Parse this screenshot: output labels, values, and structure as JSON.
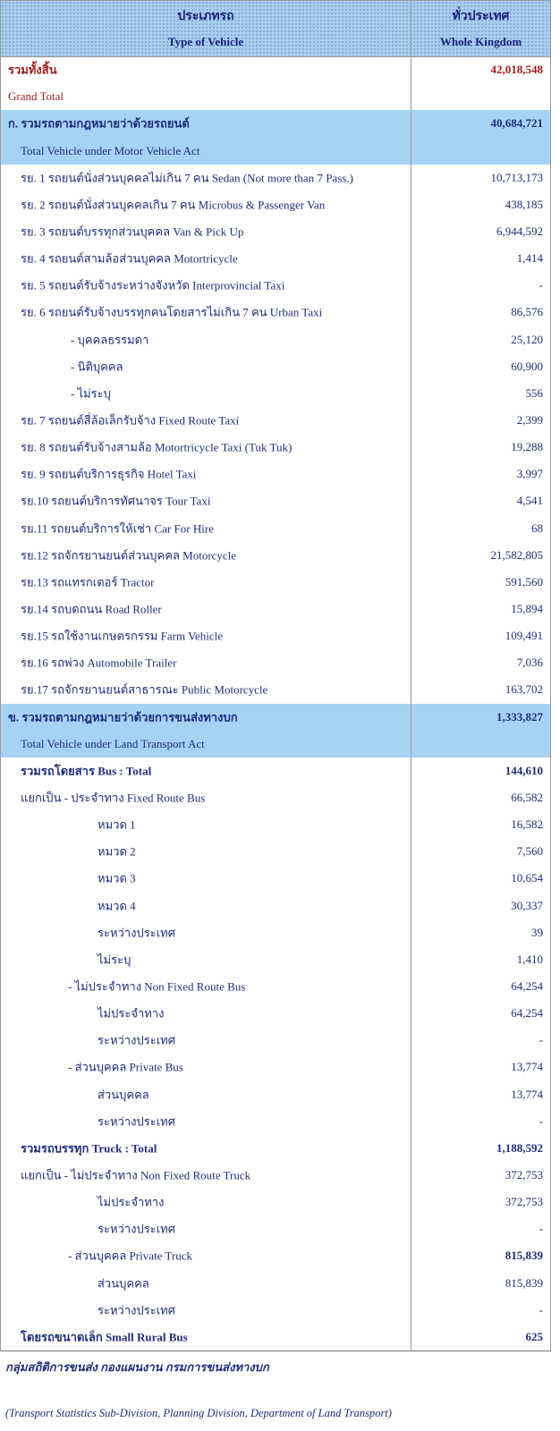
{
  "header": {
    "col1_th": "ประเภทรถ",
    "col1_en": "Type of Vehicle",
    "col2_th": "ทั่วประเทศ",
    "col2_en": "Whole Kingdom"
  },
  "rows": [
    {
      "label": "รวมทั้งสิ้น",
      "value": "42,018,548",
      "indent": 8,
      "style": "red-bold"
    },
    {
      "label": "Grand Total",
      "value": "",
      "indent": 8,
      "style": "red"
    },
    {
      "label": "ก. รวมรถตามกฎหมายว่าด้วยรถยนต์",
      "value": "40,684,721",
      "indent": 8,
      "style": "bold",
      "hl": true
    },
    {
      "label": "Total Vehicle under Motor Vehicle Act",
      "value": "",
      "indent": 22,
      "style": "",
      "hl": true
    },
    {
      "label": "รย. 1 รถยนต์นั่งส่วนบุคคลไม่เกิน 7 คน Sedan (Not more than 7 Pass.)",
      "value": "10,713,173",
      "indent": 22
    },
    {
      "label": "รย. 2 รถยนต์นั่งส่วนบุคคลเกิน 7 คน Microbus & Passenger Van",
      "value": "438,185",
      "indent": 22
    },
    {
      "label": "รย. 3 รถยนต์บรรทุกส่วนบุคคล Van & Pick Up",
      "value": "6,944,592",
      "indent": 22
    },
    {
      "label": "รย. 4 รถยนต์สามล้อส่วนบุคคล Motortricycle",
      "value": "1,414",
      "indent": 22
    },
    {
      "label": "รย. 5 รถยนต์รับจ้างระหว่างจังหวัด Interprovincial Taxi",
      "value": "-",
      "indent": 22
    },
    {
      "label": "รย. 6 รถยนต์รับจ้างบรรทุกคนโดยสารไม่เกิน 7 คน Urban Taxi",
      "value": "86,576",
      "indent": 22
    },
    {
      "label": "- บุคคลธรรมดา",
      "value": "25,120",
      "indent": 78
    },
    {
      "label": "- นิติบุคคล",
      "value": "60,900",
      "indent": 78
    },
    {
      "label": "- ไม่ระบุ",
      "value": "556",
      "indent": 78
    },
    {
      "label": "รย. 7 รถยนต์สี่ล้อเล็กรับจ้าง Fixed Route Taxi",
      "value": "2,399",
      "indent": 22
    },
    {
      "label": "รย. 8 รถยนต์รับจ้างสามล้อ Motortricycle Taxi (Tuk Tuk)",
      "value": "19,288",
      "indent": 22
    },
    {
      "label": "รย. 9 รถยนต์บริการธุรกิจ Hotel Taxi",
      "value": "3,997",
      "indent": 22
    },
    {
      "label": "รย.10 รถยนต์บริการทัศนาจร Tour Taxi",
      "value": "4,541",
      "indent": 22
    },
    {
      "label": "รย.11 รถยนต์บริการให้เช่า Car For Hire",
      "value": "68",
      "indent": 22
    },
    {
      "label": "รย.12 รถจักรยานยนต์ส่วนบุคคล Motorcycle",
      "value": "21,582,805",
      "indent": 22
    },
    {
      "label": "รย.13 รถแทรกเตอร์ Tractor",
      "value": "591,560",
      "indent": 22
    },
    {
      "label": "รย.14 รถบดถนน Road Roller",
      "value": "15,894",
      "indent": 22
    },
    {
      "label": "รย.15 รถใช้งานเกษตรกรรม Farm Vehicle",
      "value": "109,491",
      "indent": 22
    },
    {
      "label": "รย.16 รถพ่วง Automobile Trailer",
      "value": "7,036",
      "indent": 22
    },
    {
      "label": "รย.17 รถจักรยานยนต์สาธารณะ Public Motorcycle",
      "value": "163,702",
      "indent": 22
    },
    {
      "label": "ข. รวมรถตามกฎหมายว่าด้วยการขนส่งทางบก",
      "value": "1,333,827",
      "indent": 8,
      "style": "bold",
      "hl": true
    },
    {
      "label": "Total Vehicle under Land Transport Act",
      "value": "",
      "indent": 22,
      "style": "",
      "hl": true
    },
    {
      "label": "รวมรถโดยสาร Bus : Total",
      "value": "144,610",
      "indent": 22,
      "style": "bold"
    },
    {
      "label": "แยกเป็น - ประจำทาง Fixed Route Bus",
      "value": "66,582",
      "indent": 22
    },
    {
      "label": "หมวด 1",
      "value": "16,582",
      "indent": 108
    },
    {
      "label": "หมวด 2",
      "value": "7,560",
      "indent": 108
    },
    {
      "label": "หมวด 3",
      "value": "10,654",
      "indent": 108
    },
    {
      "label": "หมวด 4",
      "value": "30,337",
      "indent": 108
    },
    {
      "label": "ระหว่างประเทศ",
      "value": "39",
      "indent": 108
    },
    {
      "label": "ไม่ระบุ",
      "value": "1,410",
      "indent": 108
    },
    {
      "label": "- ไม่ประจำทาง Non Fixed Route Bus",
      "value": "64,254",
      "indent": 75
    },
    {
      "label": "ไม่ประจำทาง",
      "value": "64,254",
      "indent": 108
    },
    {
      "label": "ระหว่างประเทศ",
      "value": "-",
      "indent": 108
    },
    {
      "label": "- ส่วนบุคคล Private Bus",
      "value": "13,774",
      "indent": 75
    },
    {
      "label": "ส่วนบุคคล",
      "value": "13,774",
      "indent": 108
    },
    {
      "label": "ระหว่างประเทศ",
      "value": "-",
      "indent": 108
    },
    {
      "label": "รวมรถบรรทุก Truck : Total",
      "value": "1,188,592",
      "indent": 22,
      "style": "bold"
    },
    {
      "label": "แยกเป็น - ไม่ประจำทาง Non Fixed Route Truck",
      "value": "372,753",
      "indent": 22
    },
    {
      "label": "ไม่ประจำทาง",
      "value": "372,753",
      "indent": 108
    },
    {
      "label": "ระหว่างประเทศ",
      "value": "-",
      "indent": 108
    },
    {
      "label": "- ส่วนบุคคล Private Truck",
      "value": "815,839",
      "indent": 75,
      "valbold": true
    },
    {
      "label": "ส่วนบุคคล",
      "value": "815,839",
      "indent": 108
    },
    {
      "label": "ระหว่างประเทศ",
      "value": "-",
      "indent": 108
    },
    {
      "label": "โดยรถขนาดเล็ก Small Rural Bus",
      "value": "625",
      "indent": 22,
      "style": "bold"
    }
  ],
  "footer": {
    "line1": "กลุ่มสถิติการขนส่ง  กองแผนงาน  กรมการขนส่งทางบก",
    "line2": "(Transport Statistics Sub-Division, Planning Division, Department of Land Transport)"
  }
}
